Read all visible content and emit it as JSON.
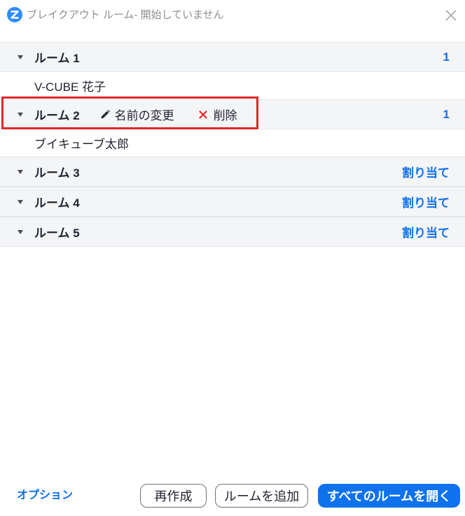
{
  "window": {
    "title": "ブレイクアウト ルーム- 開始していません"
  },
  "rooms": [
    {
      "name": "ルーム 1",
      "participant_count": 1,
      "members": [
        "V-CUBE 花子"
      ]
    },
    {
      "name": "ルーム 2",
      "participant_count": 1,
      "members": [
        "ブイキューブ太郎"
      ],
      "rename_label": "名前の変更",
      "delete_label": "削除"
    },
    {
      "name": "ルーム 3",
      "assign_label": "割り当て",
      "members": []
    },
    {
      "name": "ルーム 4",
      "assign_label": "割り当て",
      "members": []
    },
    {
      "name": "ルーム 5",
      "assign_label": "割り当て",
      "members": []
    }
  ],
  "footer": {
    "options_label": "オプション",
    "recreate_label": "再作成",
    "add_room_label": "ルームを追加",
    "open_all_label": "すべてのルームを開く"
  },
  "icons": {
    "logo": "zoom-logo-icon",
    "close": "close-icon",
    "expand": "chevron-down-icon",
    "rename": "pencil-icon",
    "delete": "delete-x-icon"
  },
  "colors": {
    "accent": "#0e71eb",
    "highlight": "#e3262a",
    "danger": "#e02828",
    "primary": "#0e72ed"
  }
}
